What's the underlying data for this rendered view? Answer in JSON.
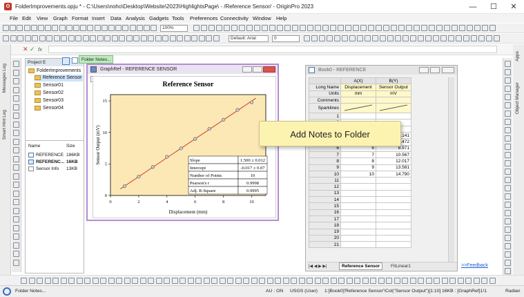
{
  "window": {
    "title": "FolderImprovements.opju * - C:\\Users\\noho\\Desktop\\Website\\2023\\HighlightsPage\\ - /Reference Sensor/ - OriginPro 2023",
    "minimize": "—",
    "maximize": "☐",
    "close": "✕"
  },
  "menu": [
    "File",
    "Edit",
    "View",
    "Graph",
    "Format",
    "Insert",
    "Data",
    "Analysis",
    "Gadgets",
    "Tools",
    "Preferences",
    "Connectivity",
    "Window",
    "Help"
  ],
  "toolbar": {
    "zoom": "100%",
    "font": "Default: Arial",
    "font_size": "0",
    "fx": "fx"
  },
  "left_tabs": [
    "Messages Log",
    "Smart Hint Log"
  ],
  "right_tabs": [
    "Apps",
    "Object Manager"
  ],
  "project_explorer": {
    "header": "Project E",
    "folder_notes_tip": "Folder Notes...",
    "root": "FolderImprovements",
    "folders": [
      "Reference Sensor",
      "Sensor01",
      "Sensor02",
      "Sensor03",
      "Sensor04"
    ],
    "file_headers": {
      "name": "Name",
      "size": "Size"
    },
    "files": [
      {
        "name": "REFERENCE",
        "size": "186KB"
      },
      {
        "name": "REFERENC...",
        "size": "16KB"
      },
      {
        "name": "Sensor Info",
        "size": "13KB"
      }
    ]
  },
  "graph_window": {
    "title": "GraphRef - REFERENCE SENSOR",
    "layer": "1"
  },
  "chart_data": {
    "type": "scatter",
    "title": "Reference Sensor",
    "xlabel": "Displacement (mm)",
    "ylabel": "Sensor Output (mV)",
    "xlim": [
      0,
      11
    ],
    "ylim": [
      0,
      16
    ],
    "xticks": [
      0,
      2,
      4,
      6,
      8,
      10
    ],
    "yticks": [
      0,
      5,
      10,
      15
    ],
    "x": [
      1,
      2,
      3,
      4,
      5,
      6,
      7,
      8,
      9,
      10
    ],
    "y": [
      1.49,
      2.99,
      4.52,
      6.141,
      7.472,
      8.971,
      10.567,
      12.017,
      13.581,
      14.79
    ],
    "fit": {
      "slope": 1.5,
      "intercept": -0.017
    },
    "stats": [
      {
        "label": "Slope",
        "value": "1.500 ± 0.012"
      },
      {
        "label": "Intercept",
        "value": "-0.017 ± 0.07"
      },
      {
        "label": "Number of Points",
        "value": "10"
      },
      {
        "label": "Pearson's r",
        "value": "0.9998"
      },
      {
        "label": "Adj. R-Square",
        "value": "0.9995"
      }
    ]
  },
  "workbook": {
    "title": "Book0 - REFERENCE",
    "col_headers": [
      "A(X)",
      "B(Y)"
    ],
    "label_rows": [
      {
        "label": "Long Name",
        "a": "Displacement",
        "b": "Sensor Output"
      },
      {
        "label": "Units",
        "a": "mm",
        "b": "mV"
      },
      {
        "label": "Comments",
        "a": "",
        "b": ""
      },
      {
        "label": "Sparklines",
        "a": "",
        "b": ""
      }
    ],
    "rows": [
      {
        "n": "1",
        "a": "",
        "b": ""
      },
      {
        "n": "2",
        "a": "",
        "b": ""
      },
      {
        "n": "3",
        "a": "",
        "b": ""
      },
      {
        "n": "4",
        "a": "4",
        "b": "6.141"
      },
      {
        "n": "5",
        "a": "5",
        "b": "7.472"
      },
      {
        "n": "6",
        "a": "6",
        "b": "8.971"
      },
      {
        "n": "7",
        "a": "7",
        "b": "10.567"
      },
      {
        "n": "8",
        "a": "8",
        "b": "12.017"
      },
      {
        "n": "9",
        "a": "9",
        "b": "13.581"
      },
      {
        "n": "10",
        "a": "10",
        "b": "14.790"
      },
      {
        "n": "11",
        "a": "",
        "b": ""
      },
      {
        "n": "12",
        "a": "",
        "b": ""
      },
      {
        "n": "13",
        "a": "",
        "b": ""
      },
      {
        "n": "14",
        "a": "",
        "b": ""
      },
      {
        "n": "15",
        "a": "",
        "b": ""
      },
      {
        "n": "16",
        "a": "",
        "b": ""
      },
      {
        "n": "17",
        "a": "",
        "b": ""
      },
      {
        "n": "18",
        "a": "",
        "b": ""
      },
      {
        "n": "19",
        "a": "",
        "b": ""
      },
      {
        "n": "20",
        "a": "",
        "b": ""
      },
      {
        "n": "21",
        "a": "",
        "b": ""
      }
    ],
    "sheet_tabs": [
      "Reference Sensor",
      "FitLinear1"
    ]
  },
  "callout": "Add Notes to Folder",
  "feedback": ">>Feedback",
  "status": {
    "left": "Folder Notes...",
    "au": "AU : ON",
    "usgs": "USGS (User)",
    "ref": "1:[Book0]'Reference Sensor'!Col(\"Sensor Output\")[1:10]",
    "size": "16KB : [GraphRef]1!1",
    "unit": "Radian"
  }
}
